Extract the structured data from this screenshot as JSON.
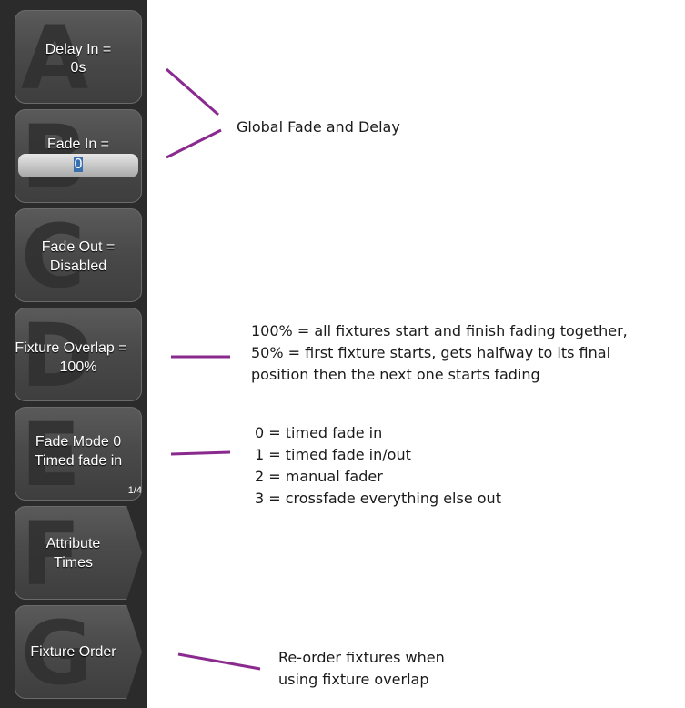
{
  "softkeys": [
    {
      "letter": "A",
      "line1": "Delay In =",
      "line2": "0s"
    },
    {
      "letter": "B",
      "line1": "Fade In =",
      "input_value": "0"
    },
    {
      "letter": "C",
      "line1": "Fade Out =",
      "line2": "Disabled"
    },
    {
      "letter": "D",
      "line1": "Fixture Overlap =",
      "line2": "100%"
    },
    {
      "letter": "E",
      "line1": "Fade Mode 0",
      "line2": "Timed fade in",
      "page": "1/4"
    },
    {
      "letter": "F",
      "line1": "Attribute",
      "line2": "Times"
    },
    {
      "letter": "G",
      "line1": "Fixture Order"
    }
  ],
  "annotations": {
    "global": "Global Fade and Delay",
    "overlap": [
      "100% = all fixtures start and finish fading together,",
      "50% = first fixture starts, gets halfway to its final",
      "position then the next one starts fading"
    ],
    "fade_mode": [
      "0 = timed fade in",
      "1 = timed fade in/out",
      "2 = manual fader",
      "3 = crossfade everything else out"
    ],
    "fixture_order": [
      "Re-order fixtures when",
      "using fixture overlap"
    ]
  },
  "colors": {
    "panel": "#2b2b2b",
    "line": "#8a2a8f"
  }
}
